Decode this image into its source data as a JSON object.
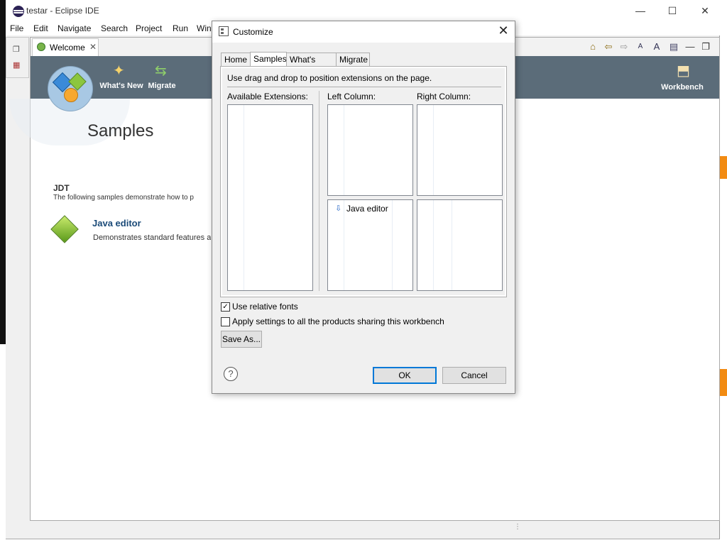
{
  "window": {
    "title": "testar - Eclipse IDE",
    "minimize": "—",
    "maximize": "☐",
    "close": "✕"
  },
  "menu": [
    "File",
    "Edit",
    "Navigate",
    "Search",
    "Project",
    "Run",
    "Win"
  ],
  "editor": {
    "tab_label": "Welcome",
    "tab_close": "✕"
  },
  "toolbar_icons": [
    "home-icon",
    "back-icon",
    "forward-icon",
    "increase-font-icon",
    "decrease-font-icon",
    "customize-page-icon",
    "minimize-icon",
    "restore-icon"
  ],
  "toolbar_glyphs": {
    "home": "⌂",
    "back": "⇦",
    "forward": "⇨",
    "font_up": "A",
    "font_down": "A",
    "customize": "▤",
    "minimize": "—",
    "restore": "❐"
  },
  "welcome": {
    "banner_links": [
      {
        "label": "What's New",
        "glyph": "✦"
      },
      {
        "label": "Migrate",
        "glyph": "⇆"
      },
      {
        "label": "Workbench",
        "glyph": "⬒"
      }
    ],
    "page_title": "Samples",
    "section_title": "JDT",
    "section_desc": "The following samples demonstrate how to p",
    "sample_title": "Java editor",
    "sample_desc": "Demonstrates standard features a"
  },
  "dialog": {
    "title": "Customize",
    "close": "✕",
    "tabs": [
      "Home",
      "Samples",
      "What's New",
      "Migrate"
    ],
    "active_tab": "Samples",
    "instructions": "Use drag and drop to position extensions on the page.",
    "available_label": "Available Extensions:",
    "left_label": "Left Column:",
    "right_label": "Right Column:",
    "left_bottom_entry": "Java editor",
    "entry_glyph": "⇩",
    "use_relative_fonts": {
      "label": "Use relative fonts",
      "checked": true,
      "mark": "✓"
    },
    "apply_all": {
      "label": "Apply settings to all the products sharing this workbench",
      "checked": false
    },
    "save_as": "Save As...",
    "help": "?",
    "ok": "OK",
    "cancel": "Cancel"
  },
  "status": {
    "grip": "⋮"
  },
  "colors": {
    "banner": "#5b6c79",
    "link": "#1a4a78",
    "accent_orange": "#f28b12",
    "default_button_border": "#0078d7"
  }
}
